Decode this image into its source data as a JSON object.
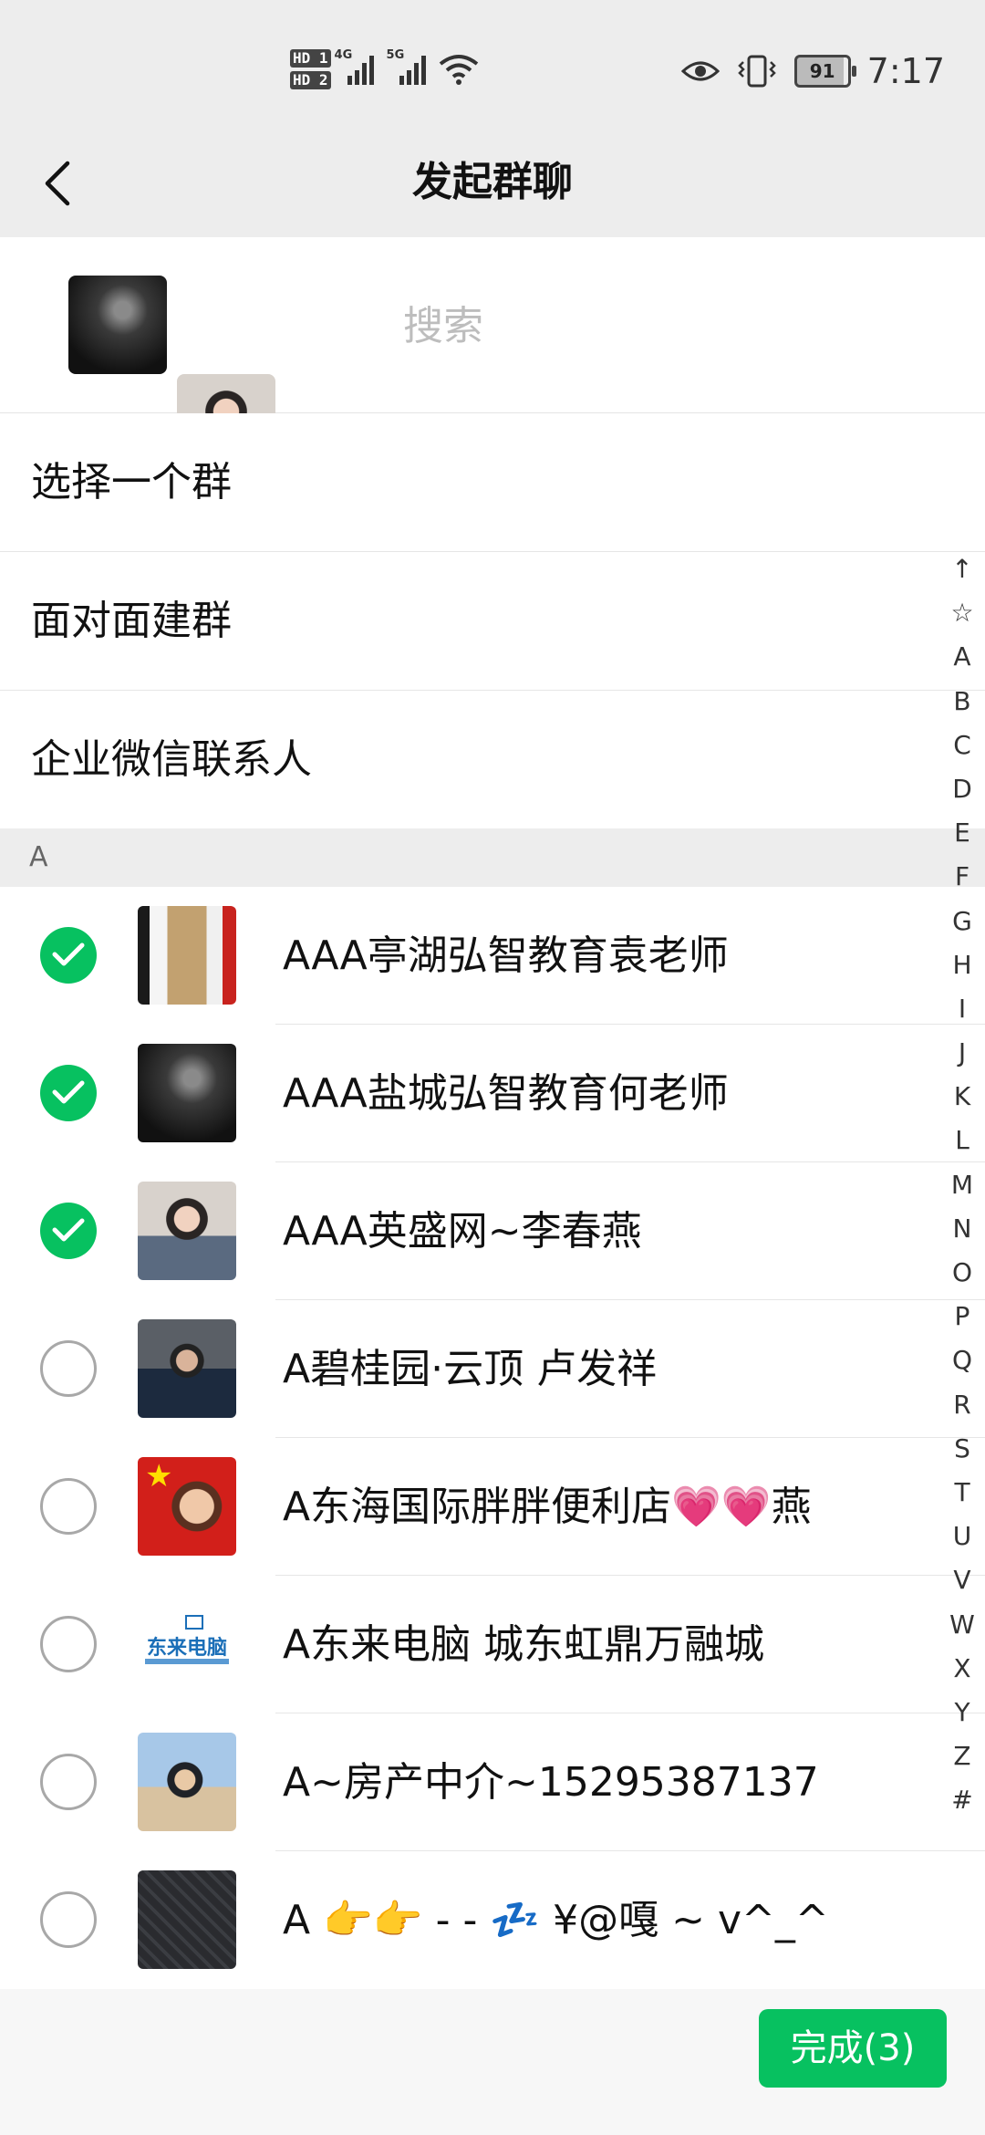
{
  "status_bar": {
    "hd1": "HD 1",
    "hd2": "HD 2",
    "net1": "4G",
    "net2": "5G",
    "battery": "91",
    "time": "7:17"
  },
  "title_bar": {
    "title": "发起群聊",
    "back_icon": "chevron-left-icon"
  },
  "search": {
    "placeholder": "搜索",
    "value": ""
  },
  "menu": [
    {
      "label": "选择一个群"
    },
    {
      "label": "面对面建群"
    },
    {
      "label": "企业微信联系人"
    }
  ],
  "section": {
    "label": "A"
  },
  "contacts": [
    {
      "name": "AAA亭湖弘智教育袁老师",
      "checked": true
    },
    {
      "name": "AAA盐城弘智教育何老师",
      "checked": true
    },
    {
      "name": "AAA英盛网~李春燕",
      "checked": true
    },
    {
      "name": "A碧桂园·云顶 卢发祥",
      "checked": false
    },
    {
      "name": "A东海国际胖胖便利店💗💗燕",
      "checked": false
    },
    {
      "name": "A东来电脑 城东虹鼎万融城",
      "checked": false
    },
    {
      "name": "A~房产中介~15295387137",
      "checked": false
    },
    {
      "name": "A  👉👉 - -  💤 ¥@嘎 ~ v^_^",
      "checked": false
    }
  ],
  "logo_text": "东来电脑",
  "index_letters": [
    "↑",
    "☆",
    "A",
    "B",
    "C",
    "D",
    "E",
    "F",
    "G",
    "H",
    "I",
    "J",
    "K",
    "L",
    "M",
    "N",
    "O",
    "P",
    "Q",
    "R",
    "S",
    "T",
    "U",
    "V",
    "W",
    "X",
    "Y",
    "Z",
    "#"
  ],
  "done_button": {
    "label": "完成(3)"
  },
  "colors": {
    "accent": "#07c160",
    "header_bg": "#ededed"
  }
}
